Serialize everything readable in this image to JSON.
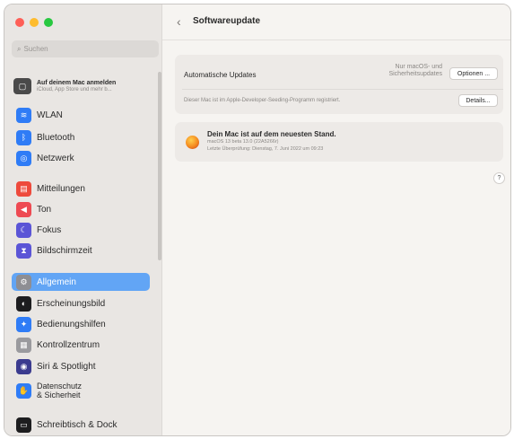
{
  "sidebar": {
    "search_placeholder": "Suchen",
    "signin": {
      "title": "Auf deinem Mac anmelden",
      "subtitle": "iCloud, App Store und mehr b..."
    },
    "items": [
      {
        "label": "WLAN",
        "icon": "wifi-icon",
        "color": "#2f7cf6",
        "glyph": "≋"
      },
      {
        "label": "Bluetooth",
        "icon": "bluetooth-icon",
        "color": "#2f7cf6",
        "glyph": "ᛒ"
      },
      {
        "label": "Netzwerk",
        "icon": "network-icon",
        "color": "#2f7cf6",
        "glyph": "◎"
      },
      {
        "label": "Mitteilungen",
        "icon": "notifications-icon",
        "color": "#ee4a3c",
        "glyph": "▤"
      },
      {
        "label": "Ton",
        "icon": "sound-icon",
        "color": "#ee4a52",
        "glyph": "◀"
      },
      {
        "label": "Fokus",
        "icon": "focus-icon",
        "color": "#5b55d6",
        "glyph": "☾"
      },
      {
        "label": "Bildschirmzeit",
        "icon": "screen-time-icon",
        "color": "#5b55d6",
        "glyph": "⧗"
      },
      {
        "label": "Allgemein",
        "icon": "gear-icon",
        "color": "#8e8e93",
        "glyph": "⚙",
        "selected": true
      },
      {
        "label": "Erscheinungsbild",
        "icon": "appearance-icon",
        "color": "#1d1d1f",
        "glyph": "◐"
      },
      {
        "label": "Bedienungshilfen",
        "icon": "accessibility-icon",
        "color": "#2f7cf6",
        "glyph": "✦"
      },
      {
        "label": "Kontrollzentrum",
        "icon": "control-center-icon",
        "color": "#9a9a9e",
        "glyph": "▦"
      },
      {
        "label": "Siri & Spotlight",
        "icon": "siri-icon",
        "color": "#3b3b8f",
        "glyph": "◉"
      },
      {
        "label": "Datenschutz\n& Sicherheit",
        "icon": "privacy-hand-icon",
        "color": "#2f7cf6",
        "glyph": "✋"
      },
      {
        "label": "Schreibtisch & Dock",
        "icon": "dock-icon",
        "color": "#1d1d1f",
        "glyph": "▭"
      }
    ]
  },
  "header": {
    "title": "Softwareupdate"
  },
  "updates_card": {
    "auto_label": "Automatische Updates",
    "auto_value_line1": "Nur macOS- und",
    "auto_value_line2": "Sicherheitsupdates",
    "options_button": "Optionen ...",
    "seeding_text": "Dieser Mac ist im Apple-Developer-Seeding-Programm registriert.",
    "details_button": "Details..."
  },
  "status_card": {
    "title": "Dein Mac ist auf dem neuesten Stand.",
    "version": "macOS 13 beta 13.0 (22A5266r)",
    "last_check": "Letzte Überprüfung: Dienstag, 7. Juni 2022 um 09:23"
  },
  "help": "?"
}
